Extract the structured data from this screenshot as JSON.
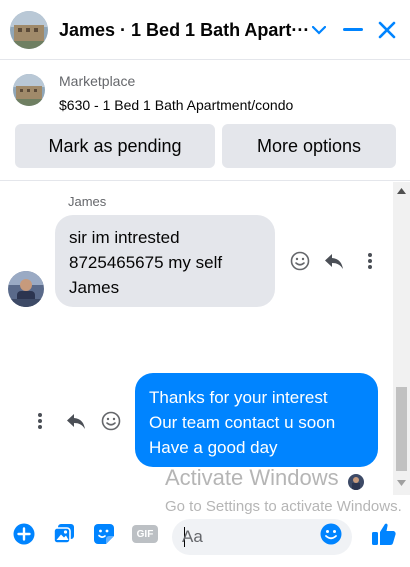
{
  "header": {
    "title": "James · 1 Bed 1 Bath Apart···"
  },
  "marketplace": {
    "label": "Marketplace",
    "item": "$630 - 1 Bed 1 Bath Apartment/condo",
    "buttons": {
      "mark_pending": "Mark as pending",
      "more_options": "More options"
    }
  },
  "chat": {
    "sender_name": "James",
    "incoming_lines": [
      "sir im intrested",
      "8725465675 my self",
      "James"
    ],
    "outgoing_lines": [
      "Thanks for your interest",
      "Our team contact u soon",
      "Have a good day"
    ]
  },
  "watermark": {
    "line1": "Activate Windows",
    "line2": "Go to Settings to activate Windows."
  },
  "composer": {
    "placeholder": "Aa",
    "gif_label": "GIF"
  },
  "colors": {
    "accent": "#0084ff",
    "bubble_in": "#e4e6eb",
    "button_bg": "#e4e6eb",
    "muted_text": "#65676b"
  },
  "icons": [
    "minimize-icon",
    "close-icon",
    "chevron-down-icon",
    "smiley-icon",
    "reply-icon",
    "more-vertical-icon",
    "plus-circle-icon",
    "photo-icon",
    "sticker-icon",
    "gif-icon",
    "emoji-icon",
    "thumbs-up-icon"
  ]
}
